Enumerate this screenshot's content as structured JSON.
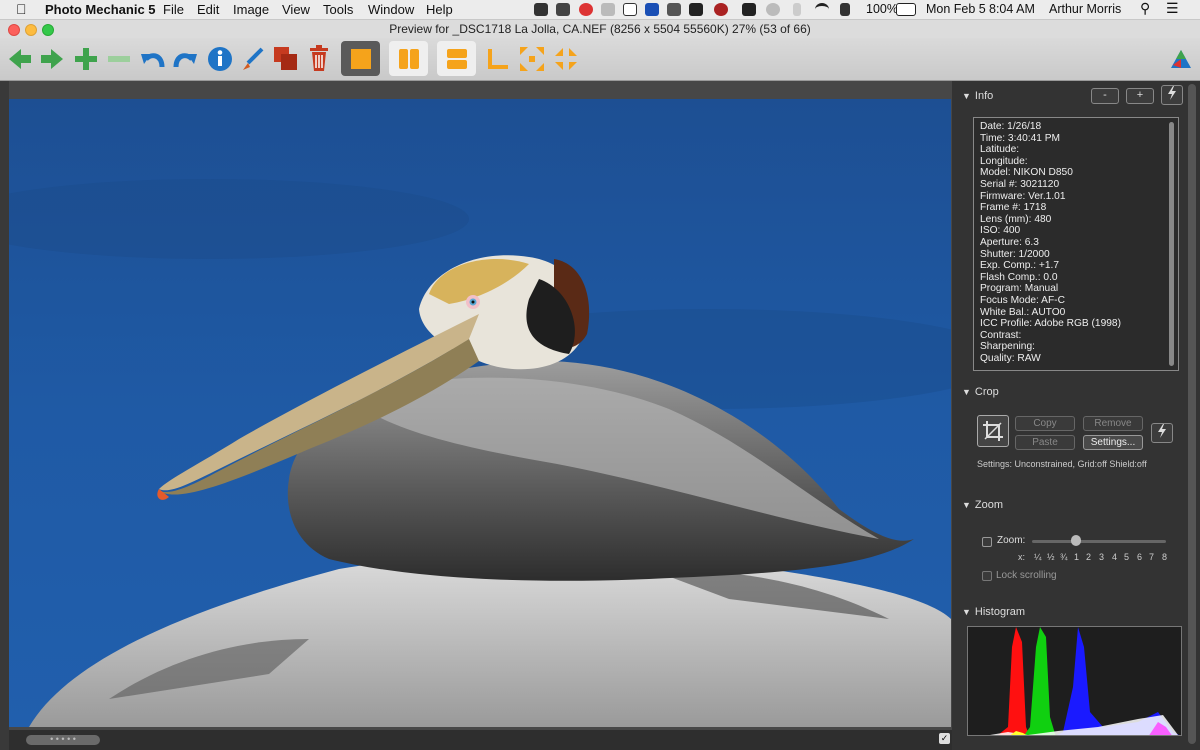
{
  "menubar": {
    "app_name": "Photo Mechanic 5",
    "menus": [
      "File",
      "Edit",
      "Image",
      "View",
      "Tools",
      "Window",
      "Help"
    ],
    "battery": "100%",
    "date": "Mon Feb 5",
    "time": "8:04 AM",
    "user": "Arthur Morris"
  },
  "window": {
    "title": "Preview for _DSC1718  La  Jolla, CA.NEF (8256 x 5504 55560K) 27% (53 of 66)"
  },
  "toolbar": {
    "icons": [
      "back-arrow-icon",
      "forward-arrow-icon",
      "plus-icon",
      "minus-icon",
      "rotate-left-icon",
      "rotate-right-icon",
      "info-icon",
      "edit-brush-icon",
      "copy-stack-icon",
      "trash-icon",
      "single-view-icon",
      "side-by-side-icon",
      "stacked-view-icon",
      "crop-corner-icon",
      "fit-expand-icon",
      "fit-contract-icon"
    ]
  },
  "panel": {
    "info": {
      "heading": "Info",
      "minus_label": "-",
      "plus_label": "+",
      "lines": [
        "Date: 1/26/18",
        "Time: 3:40:41 PM",
        "Latitude:",
        "Longitude:",
        "Model: NIKON D850",
        "Serial #: 3021120",
        "Firmware: Ver.1.01",
        "Frame #: 1718",
        "Lens (mm): 480",
        "ISO: 400",
        "Aperture: 6.3",
        "Shutter: 1/2000",
        "Exp. Comp.: +1.7",
        "Flash Comp.: 0.0",
        "Program: Manual",
        "Focus Mode: AF-C",
        "White Bal.: AUTO0",
        "ICC Profile: Adobe RGB (1998)",
        "Contrast:",
        "Sharpening:",
        "Quality: RAW"
      ]
    },
    "crop": {
      "heading": "Crop",
      "copy_label": "Copy",
      "remove_label": "Remove",
      "paste_label": "Paste",
      "settings_label": "Settings...",
      "settings_text": "Settings:   Unconstrained, Grid:off Shield:off"
    },
    "zoom": {
      "heading": "Zoom",
      "zoom_label": "Zoom:",
      "x_label": "x:",
      "levels": [
        "¼",
        "½",
        "¾",
        "1",
        "2",
        "3",
        "4",
        "5",
        "6",
        "7",
        "8"
      ],
      "lock_label": "Lock scrolling"
    },
    "histogram": {
      "heading": "Histogram"
    }
  },
  "colors": {
    "accent_orange": "#f5a31b",
    "nav_green": "#3fa34d",
    "nav_blue": "#1f74c6"
  }
}
